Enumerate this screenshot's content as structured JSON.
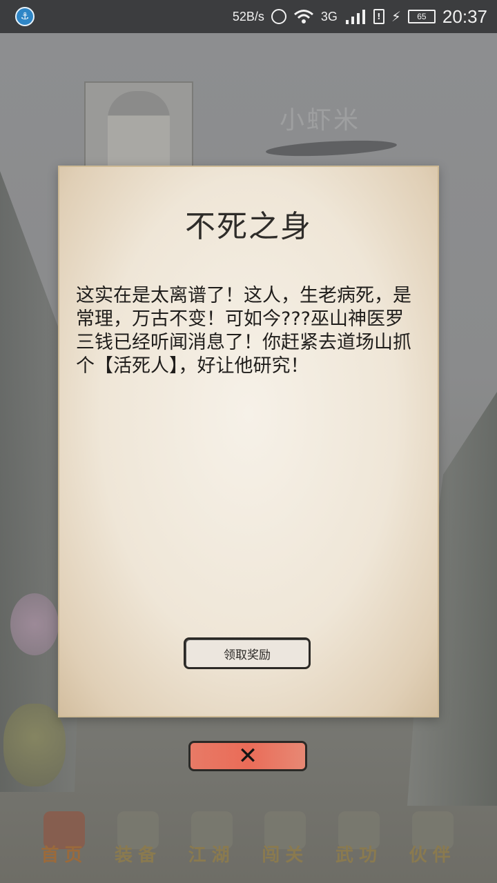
{
  "status_bar": {
    "net_speed": "52B/s",
    "network_type": "3G",
    "sim_label": "!",
    "battery_level": "65",
    "time": "20:37",
    "icons": [
      "app-icon",
      "alarm-icon",
      "wifi-icon",
      "signal-icon",
      "sim-icon",
      "charge-icon",
      "battery-icon"
    ]
  },
  "background": {
    "player_name": "小虾米"
  },
  "dialog": {
    "title": "不死之身",
    "body": "这实在是太离谱了！这人，生老病死，是常理，万古不变！可如今???巫山神医罗三钱已经听闻消息了！你赶紧去道场山抓个【活死人】，好让他研究！",
    "claim_button_label": "领取奖励",
    "close_icon": "close-icon"
  },
  "bottom_nav": {
    "items": [
      {
        "label": "首页",
        "active": true
      },
      {
        "label": "装备",
        "active": false
      },
      {
        "label": "江湖",
        "active": false
      },
      {
        "label": "闯关",
        "active": false
      },
      {
        "label": "武功",
        "active": false
      },
      {
        "label": "伙伴",
        "active": false
      }
    ]
  },
  "colors": {
    "dialog_paper": "#efe6d7",
    "close_button": "#ea6c58",
    "overlay_dim": "#6f7173"
  }
}
